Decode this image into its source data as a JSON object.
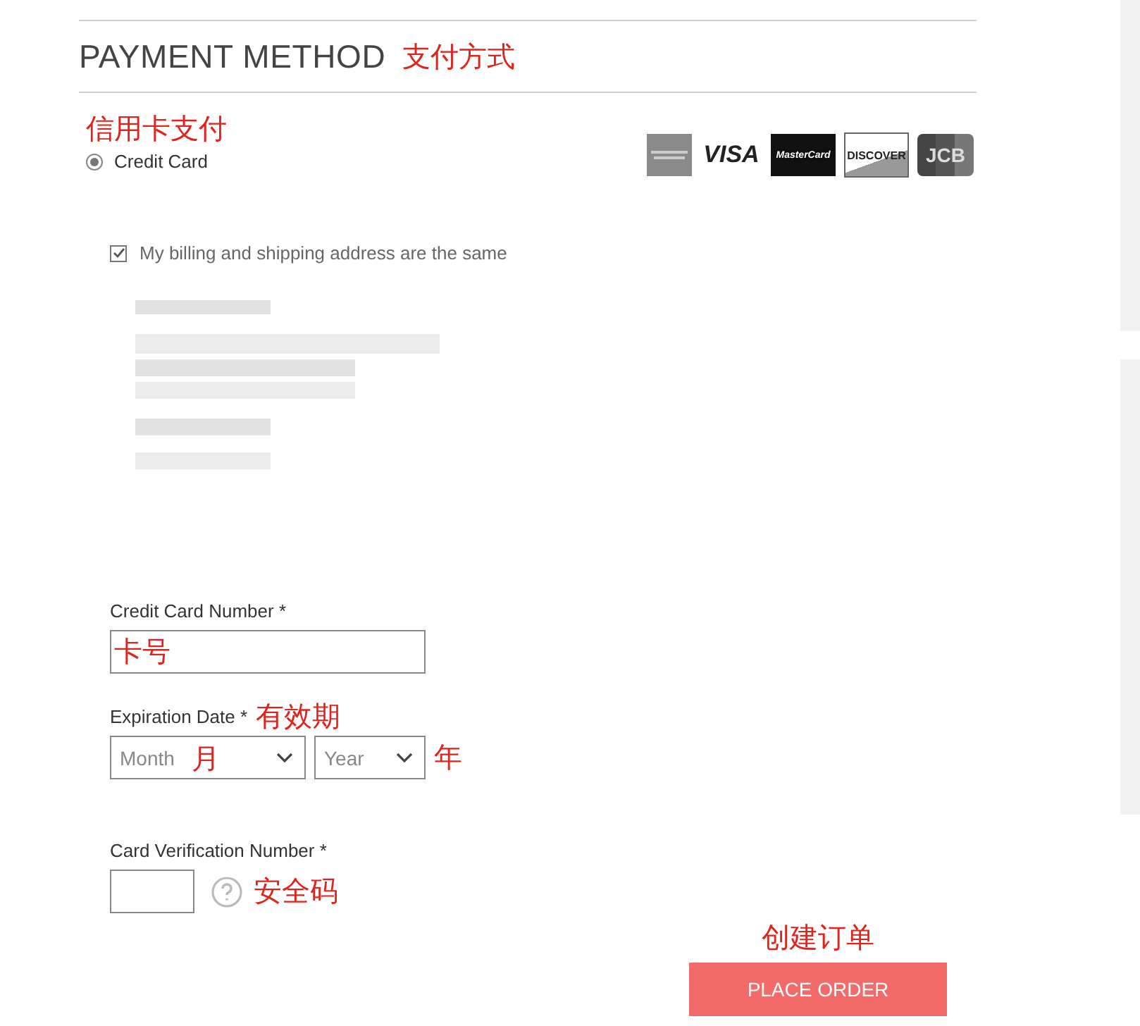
{
  "heading": {
    "title": "PAYMENT METHOD",
    "note": "支付方式"
  },
  "payment_option": {
    "note": "信用卡支付",
    "label": "Credit Card",
    "selected": true
  },
  "card_logos": [
    {
      "kind": "amex"
    },
    {
      "kind": "visa",
      "label": "VISA"
    },
    {
      "kind": "mastercard",
      "label": "MasterCard"
    },
    {
      "kind": "discover",
      "label": "DISCOVER"
    },
    {
      "kind": "jcb",
      "label": "JCB"
    }
  ],
  "same_address": {
    "label": "My billing and shipping address are the same",
    "checked": true
  },
  "card_number": {
    "label": "Credit Card Number",
    "required": "*",
    "value": "卡号"
  },
  "expiration": {
    "label": "Expiration Date",
    "required": "*",
    "note": "有效期",
    "month": {
      "placeholder": "Month",
      "note": "月"
    },
    "year": {
      "placeholder": "Year",
      "note": "年"
    }
  },
  "cvn": {
    "label": "Card Verification Number",
    "required": "*",
    "note": "安全码"
  },
  "place_order": {
    "note": "创建订单",
    "label": "PLACE ORDER"
  }
}
